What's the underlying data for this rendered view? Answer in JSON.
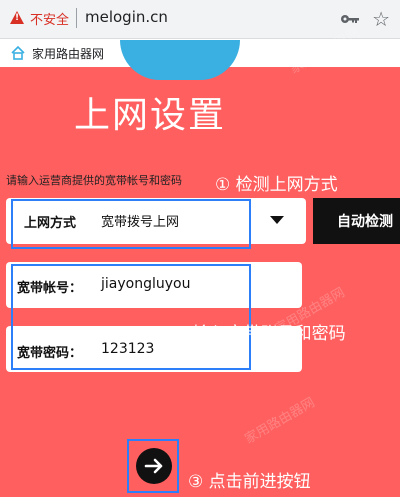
{
  "browser": {
    "security_label": "不安全",
    "url": "melogin.cn",
    "tab_title": "家用路由器网"
  },
  "watermark_text": "家用路由器网",
  "page": {
    "title": "上网设置",
    "hint": "请输入运营商提供的宽带帐号和密码"
  },
  "form": {
    "mode": {
      "label": "上网方式",
      "value": "宽带拨号上网"
    },
    "detect_button": "自动检测",
    "account": {
      "label": "宽带帐号：",
      "value": "jiayongluyou"
    },
    "password": {
      "label": "宽带密码：",
      "value": "123123"
    }
  },
  "annotations": {
    "step1": "① 检测上网方式",
    "step2": "② 输入宽带账号和密码",
    "step3": "③ 点击前进按钮"
  },
  "colors": {
    "background": "#ff5f5f",
    "highlight": "#2d7ff9",
    "logo": "#3ab0e2"
  },
  "icons": {
    "security": "warning-icon",
    "key": "key-icon",
    "bookmark": "star-icon",
    "tab": "house-icon",
    "next": "arrow-right-icon",
    "dropdown": "chevron-down-icon"
  }
}
